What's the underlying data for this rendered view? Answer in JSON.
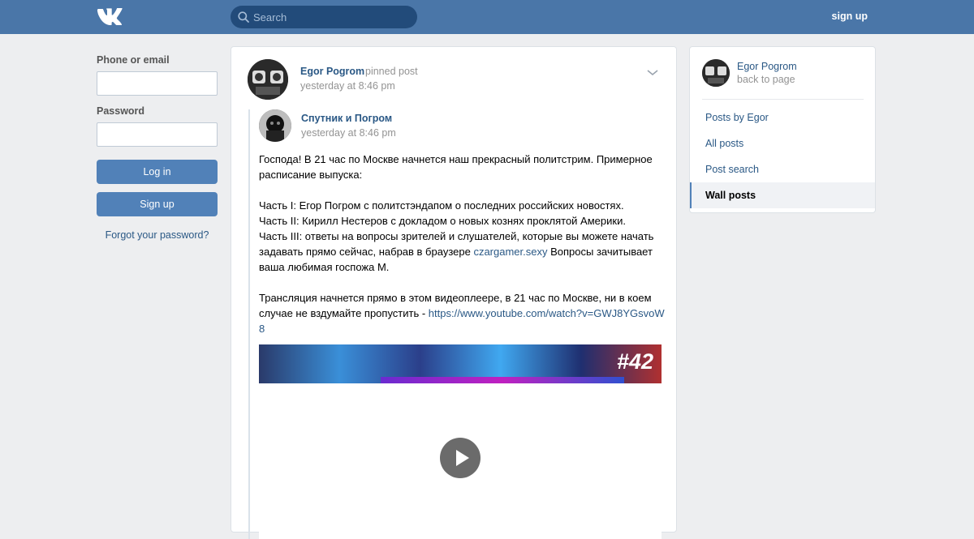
{
  "header": {
    "logo": "VK",
    "search_placeholder": "Search",
    "signup_link": "sign up"
  },
  "login": {
    "phone_label": "Phone or email",
    "password_label": "Password",
    "login_button": "Log in",
    "signup_button": "Sign up",
    "forgot_link": "Forgot your password?"
  },
  "post": {
    "author": "Egor Pogrom",
    "pinned_label": "pinned post",
    "time": "yesterday at 8:46 pm",
    "repost": {
      "author": "Спутник и Погром",
      "time": "yesterday at 8:46 pm",
      "text_intro": "Господа! В 21 час по Москве начнется наш прекрасный политстрим. Примерное расписание выпуска:\n\nЧасть I: Егор Погром с политстэндапом о последних российских новостях.\nЧасть II: Кирилл Нестеров с докладом о новых кознях проклятой Америки.\nЧасть III: ответы на вопросы зрителей и слушателей, которые вы можете начать задавать прямо сейчас, набрав в браузере ",
      "link1": "czargamer.sexy",
      "text_mid": " Вопросы зачитывает ваша любимая госпожа М.\n\nТрансляция начнется прямо в этом видеоплеере, в 21 час по Москве, ни в коем случае не вздумайте пропустить - ",
      "link2": "https://www.youtube.com/watch?v=GWJ8YGsvoW8",
      "video_tag": "#42"
    }
  },
  "sidebar": {
    "name": "Egor Pogrom",
    "back": "back to page",
    "items": [
      {
        "label": "Posts by Egor",
        "active": false
      },
      {
        "label": "All posts",
        "active": false
      },
      {
        "label": "Post search",
        "active": false
      },
      {
        "label": "Wall posts",
        "active": true
      }
    ]
  },
  "colors": {
    "header_bg": "#4a76a8",
    "page_bg": "#edeef0",
    "link": "#2a5885",
    "button": "#5181b8"
  }
}
